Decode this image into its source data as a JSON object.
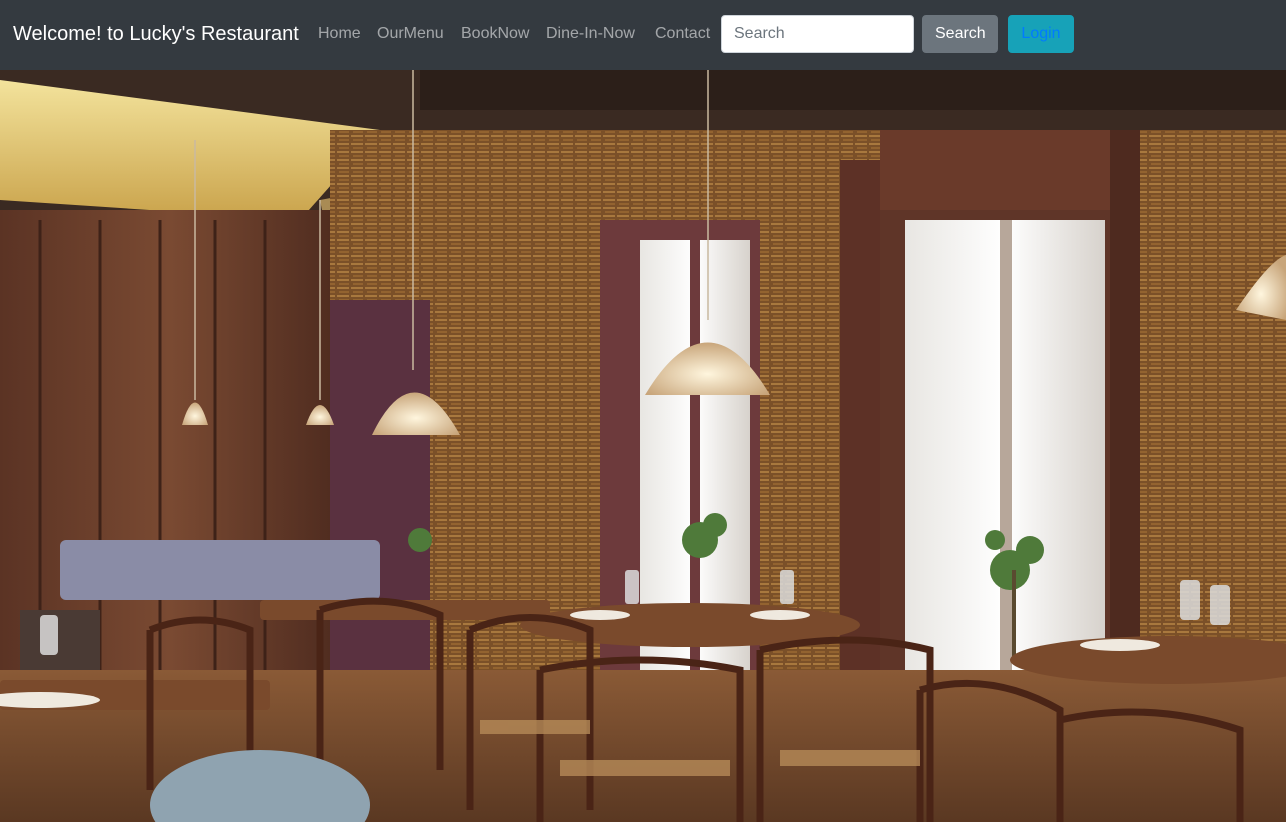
{
  "navbar": {
    "brand": "Welcome! to Lucky's Restaurant",
    "links": [
      {
        "label": "Home"
      },
      {
        "label": "OurMenu"
      },
      {
        "label": "BookNow"
      },
      {
        "label": "Dine-In-Now"
      },
      {
        "label": "Contact"
      }
    ],
    "search": {
      "placeholder": "Search",
      "value": ""
    },
    "search_button_label": "Search",
    "login_button_label": "Login"
  },
  "colors": {
    "navbar_bg": "#343a40",
    "search_button": "#6c757d",
    "login_button": "#17a2b8",
    "login_text": "#007bff"
  },
  "hero": {
    "image_subject": "restaurant-interior-photo"
  }
}
